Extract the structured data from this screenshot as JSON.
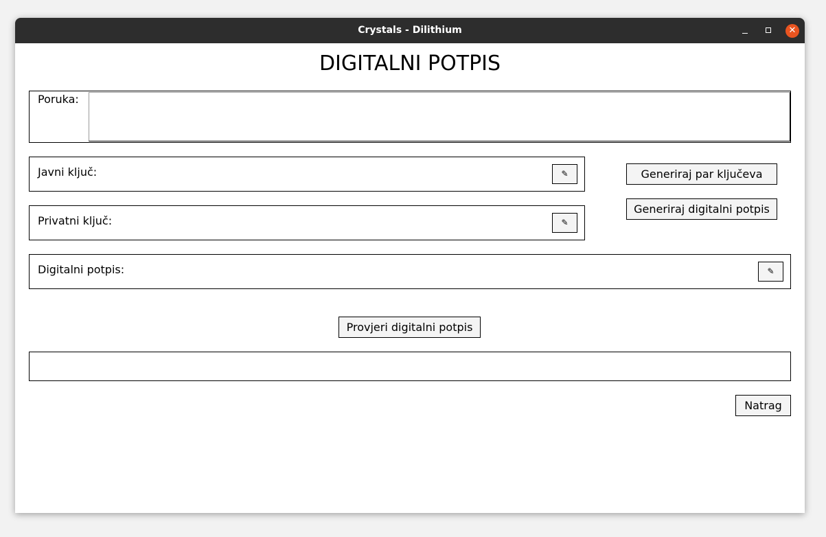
{
  "window": {
    "title": "Crystals - Dilithium",
    "close_glyph": "✕"
  },
  "heading": "DIGITALNI POTPIS",
  "message": {
    "label": "Poruka:",
    "value": ""
  },
  "public_key": {
    "label": "Javni ključ:",
    "edit_icon": "✎"
  },
  "private_key": {
    "label": "Privatni ključ:",
    "edit_icon": "✎"
  },
  "signature": {
    "label": "Digitalni potpis:",
    "edit_icon": "✎"
  },
  "buttons": {
    "generate_keypair": "Generiraj par ključeva",
    "generate_signature": "Generiraj digitalni potpis",
    "verify_signature": "Provjeri digitalni potpis",
    "back": "Natrag"
  },
  "result": {
    "value": ""
  }
}
